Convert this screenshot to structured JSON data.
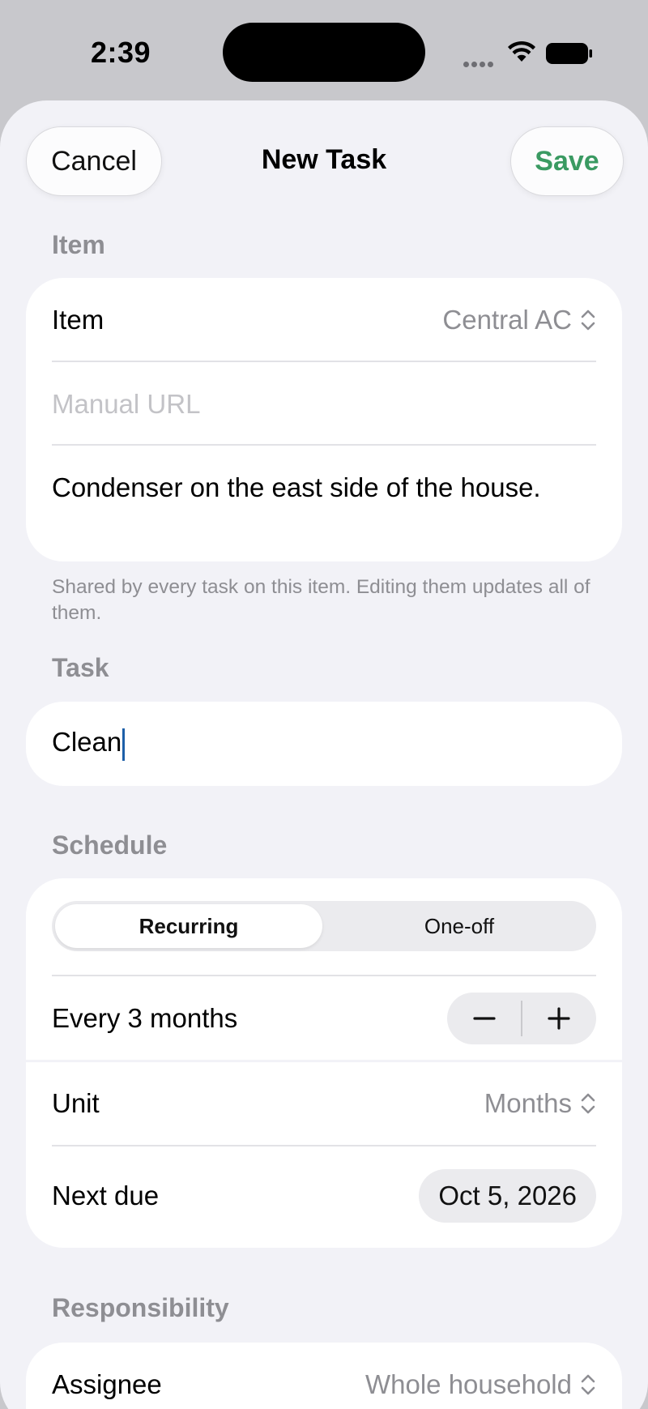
{
  "status_bar": {
    "time": "2:39"
  },
  "nav": {
    "cancel_label": "Cancel",
    "title": "New Task",
    "save_label": "Save"
  },
  "item_section": {
    "header": "Item",
    "item_label": "Item",
    "item_value": "Central AC",
    "manual_url_placeholder": "Manual URL",
    "notes_value": "Condenser on the east side of the house.",
    "footnote": "Shared by every task on this item. Editing them updates all of them."
  },
  "task_section": {
    "header": "Task",
    "task_value": "Clean"
  },
  "schedule_section": {
    "header": "Schedule",
    "segments": [
      "Recurring",
      "One-off"
    ],
    "selected_segment": "Recurring",
    "interval_label": "Every 3 months",
    "unit_label": "Unit",
    "unit_value": "Months",
    "next_due_label": "Next due",
    "next_due_value": "Oct 5, 2026"
  },
  "responsibility_section": {
    "header": "Responsibility",
    "assignee_label": "Assignee",
    "assignee_value": "Whole household"
  },
  "colors": {
    "accent_green": "#3a9a62",
    "caret_blue": "#1d5fa8",
    "background": "#f2f2f7"
  }
}
